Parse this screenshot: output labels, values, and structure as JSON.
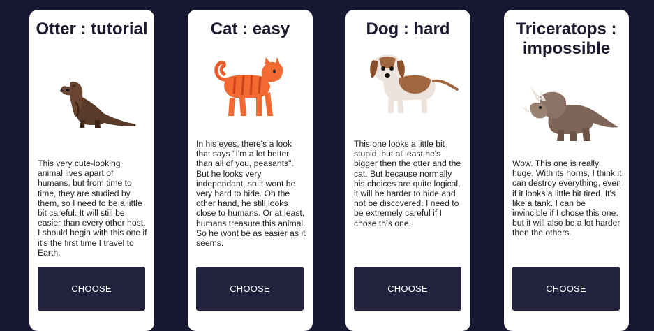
{
  "cards": [
    {
      "title": "Otter : tutorial",
      "icon": "otter-icon",
      "description": "This very cute-looking animal lives apart of humans, but from time to time, they are studied by them, so I need to be a little bit careful. It will still be easier than every other host. I should begin with this one if it's the first time I travel to Earth.",
      "button_label": "CHOOSE"
    },
    {
      "title": "Cat : easy",
      "icon": "cat-icon",
      "description": "In his eyes, there's a look that says \"I'm a lot better than all of you, peasants\". But he looks very independant, so it wont be very hard to hide. On the other hand, he still looks close to humans. Or at least, humans treasure this animal. So he wont be as easier as it seems.",
      "button_label": "CHOOSE"
    },
    {
      "title": "Dog : hard",
      "icon": "dog-icon",
      "description": "This one looks a little bit stupid, but at least he's bigger then the otter and the cat. But because normally his choices are quite logical, it will be harder to hide and not be discovered. I need to be extremely careful if I chose this one.",
      "button_label": "CHOOSE"
    },
    {
      "title": "Triceratops : impossible",
      "icon": "triceratops-icon",
      "description": "Wow. This one is really huge. With its horns, I think it can destroy everything, even if it looks a little bit tired. It's like a tank. I can be invincible if I chose this one, but it will also be a lot harder then the others.",
      "button_label": "CHOOSE"
    }
  ]
}
